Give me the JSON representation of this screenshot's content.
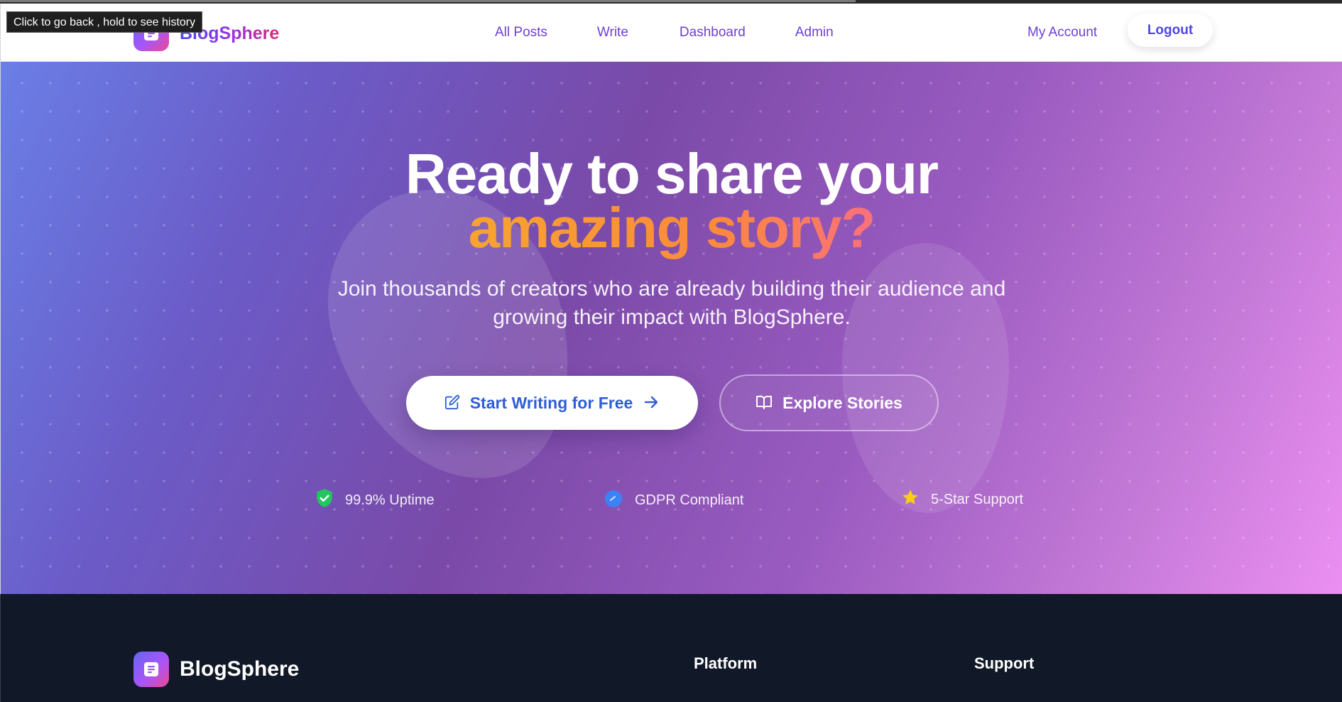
{
  "browser": {
    "tooltip": "Click to go back , hold to see history"
  },
  "nav": {
    "brand": "BlogSphere",
    "links": [
      "All Posts",
      "Write",
      "Dashboard",
      "Admin"
    ],
    "account": "My Account",
    "logout": "Logout"
  },
  "hero": {
    "title_line1": "Ready to share your",
    "title_accent": "amazing story?",
    "subtitle": "Join thousands of creators who are already building their audience and growing their impact with BlogSphere.",
    "primary_cta": "Start Writing for Free",
    "secondary_cta": "Explore Stories",
    "features": [
      {
        "icon": "shield-check-icon",
        "label": "99.9% Uptime"
      },
      {
        "icon": "gdpr-badge-icon",
        "label": "GDPR Compliant"
      },
      {
        "icon": "star-icon",
        "label": "5-Star Support"
      }
    ]
  },
  "footer": {
    "brand": "BlogSphere",
    "columns": [
      "Platform",
      "Support"
    ]
  },
  "colors": {
    "brand_indigo": "#4f46e5",
    "brand_purple": "#9333ea",
    "brand_pink": "#db2777",
    "accent_orange": "#f7a42f",
    "footer_bg": "#111827"
  }
}
